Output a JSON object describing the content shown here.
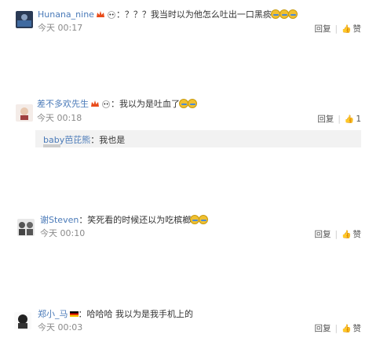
{
  "comments": [
    {
      "user": "Hunana_nine",
      "text": "：？？？我当时以为他怎么吐出一口黑痰",
      "time": "今天 00:17",
      "reply_label": "回复",
      "like_label": "赞"
    },
    {
      "user": "差不多欢先生",
      "text": "：我以为是吐血了",
      "time": "今天 00:18",
      "reply_label": "回复",
      "like_label": "1",
      "subreply": {
        "user": "baby芭芘熊",
        "text": "：我也是"
      }
    },
    {
      "user": "谢Steven",
      "text": "：笑死看的时候还以为吃槟榔",
      "time": "今天 00:10",
      "reply_label": "回复",
      "like_label": "赞"
    },
    {
      "user": "郑小_马",
      "text": "：哈哈哈 我以为是我手机上的",
      "time": "今天 00:03",
      "reply_label": "回复",
      "like_label": "赞"
    }
  ],
  "colors": {
    "link": "#4a7ab8",
    "time": "#8a8a8a",
    "subreply_bg": "#f2f2f2"
  }
}
